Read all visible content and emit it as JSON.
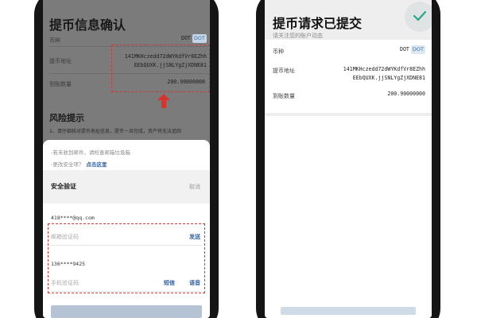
{
  "left": {
    "title": "提币信息确认",
    "coin_label": "币种",
    "coin_value": "DOT",
    "coin_tag": "DOT",
    "address_label": "提币地址",
    "address_line1": "141MKHczedd72dWYKdfVr8EZhh",
    "address_line2": "EEbQUXK.jjSNLYgZjXDNE81",
    "amount_label": "到账数量",
    "amount_value": "200.90000000",
    "risk_title": "风险提示",
    "risk_text": "1、请仔细核对提币地址信息，提币一旦完成，资产将无法追回",
    "sheet": {
      "hint1": "-若未收到邮件，请检查邮箱垃圾箱",
      "hint2_prefix": "-更改安全项？",
      "hint2_link": "点击这里",
      "header_title": "安全验证",
      "cancel": "取消",
      "email": "418****@qq.com",
      "email_placeholder": "邮箱验证码",
      "email_send": "发送",
      "phone": "136****9425",
      "phone_placeholder": "手机验证码",
      "sms": "短信",
      "voice": "语音"
    }
  },
  "right": {
    "title": "提币请求已提交",
    "subtitle": "请关注您的账户动态",
    "coin_label": "币种",
    "coin_value": "DOT",
    "coin_tag": "DOT",
    "address_label": "提币地址",
    "address_line1": "141MKHczedd72dWYKdfVr8EZhh",
    "address_line2": "EEbQUXK.jjSNLYgZjXDNE81",
    "amount_label": "到账数量",
    "amount_value": "200.90000000"
  },
  "colors": {
    "accent": "#2f5fa0",
    "highlight": "#c83a3a",
    "success": "#2aa58a"
  },
  "icons": {
    "annotation": "red-up-arrow-icon",
    "success": "check-icon"
  }
}
